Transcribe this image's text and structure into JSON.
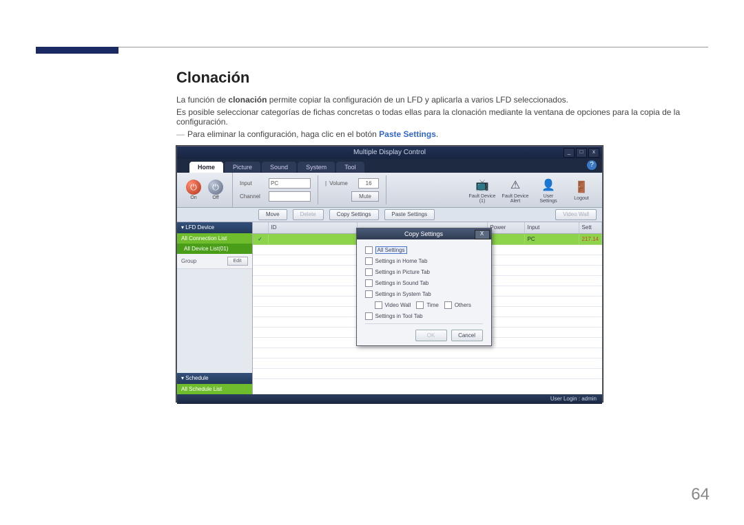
{
  "page": {
    "heading": "Clonación",
    "p1_pre": "La función de ",
    "p1_strong": "clonación",
    "p1_post": " permite copiar la configuración de un LFD y aplicarla a varios LFD seleccionados.",
    "p2": "Es posible seleccionar categorías de fichas concretas o todas ellas para la clonación mediante la ventana de opciones para la copia de la configuración.",
    "note_sep": "―",
    "note_pre": "Para eliminar la configuración, haga clic en el botón ",
    "note_link": "Paste Settings",
    "note_post": ".",
    "page_number": "64"
  },
  "app": {
    "title": "Multiple Display Control",
    "win": {
      "min": "_",
      "max": "□",
      "close": "x"
    },
    "tabs": {
      "home": "Home",
      "picture": "Picture",
      "sound": "Sound",
      "system": "System",
      "tool": "Tool"
    },
    "help": "?",
    "power": {
      "on": "On",
      "off": "Off",
      "on_glyph": "⏻",
      "off_glyph": "⏻"
    },
    "mid": {
      "input_label": "Input",
      "input_value": "PC",
      "channel_label": "Channel",
      "channel_value": "",
      "volume_label": "Volume",
      "volume_value": "16",
      "mute_btn": "Mute",
      "sep": "|"
    },
    "icons": {
      "fault_device": "Fault Device (1)",
      "fault_alert": "Fault Device Alert",
      "user_settings": "User Settings",
      "logout": "Logout",
      "fault_glyph": "📺",
      "alert_glyph": "⚠",
      "user_glyph": "👤",
      "logout_glyph": "🚪"
    },
    "actions": {
      "move": "Move",
      "delete": "Delete",
      "copy": "Copy Settings",
      "paste": "Paste Settings",
      "video_wall": "Video Wall"
    },
    "sidebar": {
      "lfd_header": "LFD Device",
      "all_conn": "All Connection List",
      "all_dev": "All Device List(01)",
      "group": "Group",
      "edit": "Edit",
      "schedule_header": "Schedule",
      "all_schedule": "All Schedule List"
    },
    "grid": {
      "chk_glyph": "✓",
      "col1": "ID",
      "col_power": "Power",
      "col_input": "Input",
      "col_sett": "Sett",
      "row_power": "",
      "row_input": "PC",
      "row_sett": "217.14"
    },
    "dialog": {
      "title": "Copy Settings",
      "close": "X",
      "all": "All Settings",
      "home": "Settings in Home Tab",
      "picture": "Settings in Picture Tab",
      "sound": "Settings in Sound Tab",
      "system": "Settings in System Tab",
      "video_wall": "Video Wall",
      "time": "Time",
      "others": "Others",
      "tool": "Settings in Tool Tab",
      "ok": "OK",
      "cancel": "Cancel"
    },
    "status": "User Login : admin"
  }
}
